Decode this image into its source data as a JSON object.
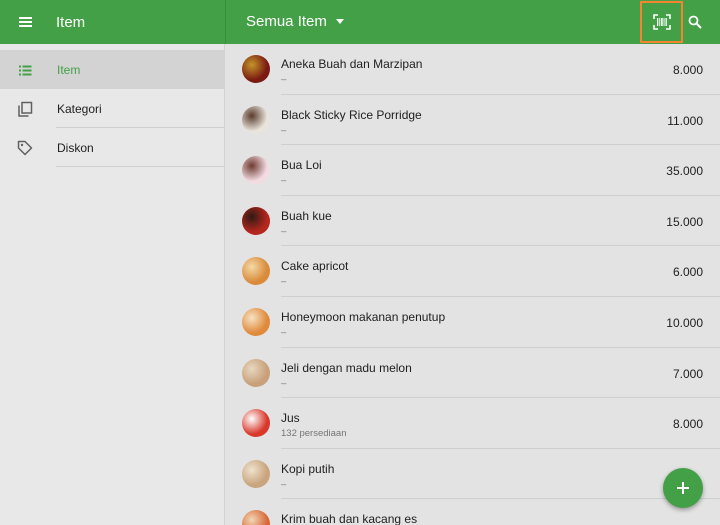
{
  "appbar": {
    "title": "Item",
    "filter_label": "Semua Item",
    "menu_icon": "hamburger-menu-icon",
    "scan_icon": "barcode-scan-icon",
    "search_icon": "search-icon",
    "color": "#43a047"
  },
  "sidebar": {
    "items": [
      {
        "label": "Item",
        "icon": "list-icon",
        "active": true
      },
      {
        "label": "Kategori",
        "icon": "copy-icon",
        "active": false
      },
      {
        "label": "Diskon",
        "icon": "tag-icon",
        "active": false
      }
    ]
  },
  "items": [
    {
      "name": "Aneka Buah dan Marzipan",
      "sub": "–",
      "price": "8.000",
      "thumb_colors": [
        "#7a1a12",
        "#c2952a"
      ]
    },
    {
      "name": "Black Sticky Rice Porridge",
      "sub": "–",
      "price": "11.000",
      "thumb_colors": [
        "#e9e4dc",
        "#5a3b2c"
      ]
    },
    {
      "name": "Bua Loi",
      "sub": "–",
      "price": "35.000",
      "thumb_colors": [
        "#f2dbe2",
        "#6e3b2f"
      ]
    },
    {
      "name": "Buah kue",
      "sub": "–",
      "price": "15.000",
      "thumb_colors": [
        "#b5261e",
        "#2f1a14"
      ]
    },
    {
      "name": "Cake apricot",
      "sub": "–",
      "price": "6.000",
      "thumb_colors": [
        "#d98b3a",
        "#f4d9a7"
      ]
    },
    {
      "name": "Honeymoon makanan penutup",
      "sub": "–",
      "price": "10.000",
      "thumb_colors": [
        "#e08a3c",
        "#f6e3c4"
      ]
    },
    {
      "name": "Jeli dengan madu melon",
      "sub": "–",
      "price": "7.000",
      "thumb_colors": [
        "#c8a07a",
        "#e8d8c0"
      ]
    },
    {
      "name": "Jus",
      "sub": "132 persediaan",
      "price": "8.000",
      "thumb_colors": [
        "#d8372a",
        "#ffffff"
      ]
    },
    {
      "name": "Kopi putih",
      "sub": "–",
      "price": "",
      "thumb_colors": [
        "#c9a47c",
        "#efe2cf"
      ]
    },
    {
      "name": "Krim buah dan kacang es",
      "sub": "",
      "price": "",
      "thumb_colors": [
        "#d86a3a",
        "#f2d6b4"
      ]
    }
  ],
  "fab": {
    "icon": "plus-icon",
    "label": "+"
  }
}
